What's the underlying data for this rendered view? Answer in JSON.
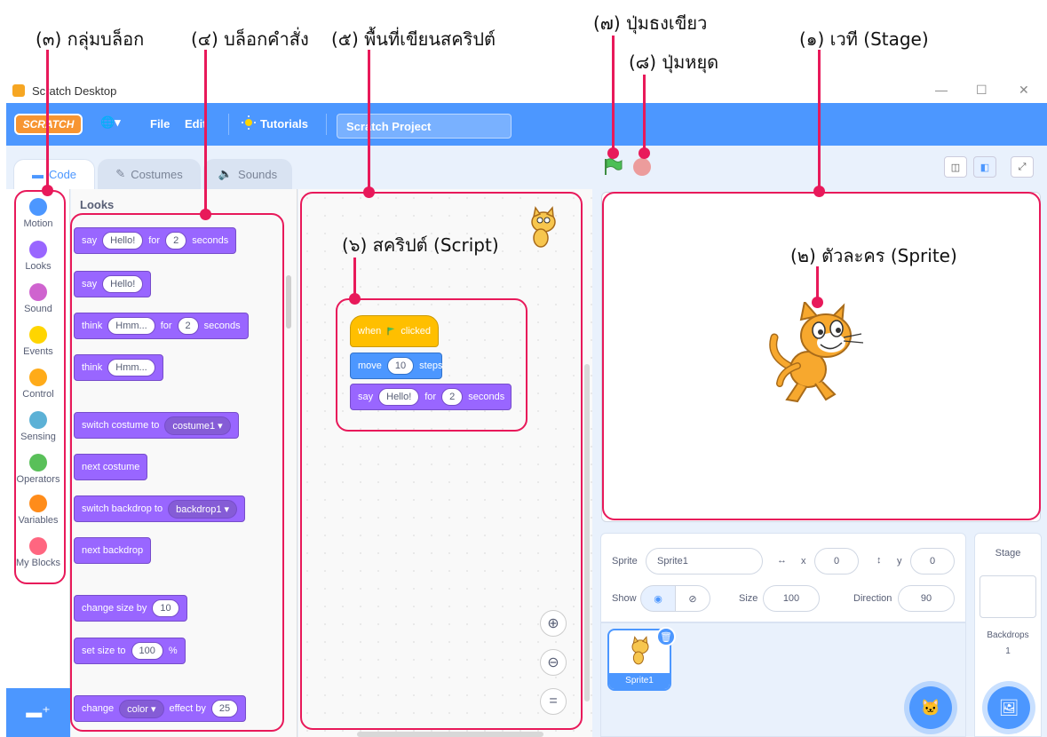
{
  "annotations": {
    "blocks_group": "(๓) กลุ่มบล็อก",
    "command_blocks": "(๔) บล็อกคำสั่ง",
    "script_area": "(๕) พื้นที่เขียนสคริปต์",
    "green_flag": "(๗) ปุ่มธงเขียว",
    "stop_button": "(๘) ปุ่มหยุด",
    "stage": "(๑) เวที (Stage)",
    "script": "(๖) สคริปต์ (Script)",
    "sprite": "(๒) ตัวละคร (Sprite)"
  },
  "window": {
    "title": "Scratch Desktop",
    "minimize": "—",
    "maximize": "☐",
    "close": "✕"
  },
  "menubar": {
    "logo": "SCRATCH",
    "globe": "🌐▾",
    "file": "File",
    "edit": "Edit",
    "tutorials": "Tutorials",
    "project_title": "Scratch Project"
  },
  "tabs": {
    "code": "Code",
    "costumes": "Costumes",
    "sounds": "Sounds"
  },
  "categories": [
    {
      "label": "Motion",
      "color": "#4c97ff"
    },
    {
      "label": "Looks",
      "color": "#9966ff"
    },
    {
      "label": "Sound",
      "color": "#cf63cf"
    },
    {
      "label": "Events",
      "color": "#ffd500"
    },
    {
      "label": "Control",
      "color": "#ffab19"
    },
    {
      "label": "Sensing",
      "color": "#5cb1d6"
    },
    {
      "label": "Operators",
      "color": "#59c059"
    },
    {
      "label": "Variables",
      "color": "#ff8c1a"
    },
    {
      "label": "My Blocks",
      "color": "#ff6680"
    }
  ],
  "palette": {
    "heading": "Looks",
    "say_for": {
      "word1": "say",
      "text": "Hello!",
      "word2": "for",
      "num": "2",
      "word3": "seconds"
    },
    "say": {
      "word1": "say",
      "text": "Hello!"
    },
    "think_for": {
      "word1": "think",
      "text": "Hmm...",
      "word2": "for",
      "num": "2",
      "word3": "seconds"
    },
    "think": {
      "word1": "think",
      "text": "Hmm..."
    },
    "switch_costume": {
      "label": "switch costume to",
      "value": "costume1 ▾"
    },
    "next_costume": "next costume",
    "switch_backdrop": {
      "label": "switch backdrop to",
      "value": "backdrop1 ▾"
    },
    "next_backdrop": "next backdrop",
    "change_size": {
      "label": "change size by",
      "num": "10"
    },
    "set_size": {
      "label": "set size to",
      "num": "100",
      "suffix": "%"
    },
    "change_effect": {
      "word1": "change",
      "value": "color ▾",
      "word2": "effect by",
      "num": "25"
    }
  },
  "script": {
    "when": "when",
    "clicked": "clicked",
    "move": "move",
    "move_num": "10",
    "steps": "steps",
    "say": "say",
    "say_text": "Hello!",
    "for": "for",
    "say_num": "2",
    "seconds": "seconds"
  },
  "zoom": {
    "in": "⊕",
    "out": "⊖",
    "reset": "="
  },
  "sprite_info": {
    "sprite_label": "Sprite",
    "sprite_name": "Sprite1",
    "x_label": "x",
    "x_value": "0",
    "y_label": "y",
    "y_value": "0",
    "show_label": "Show",
    "size_label": "Size",
    "size_value": "100",
    "direction_label": "Direction",
    "direction_value": "90"
  },
  "sprite_list": {
    "card_name": "Sprite1"
  },
  "stage_pane": {
    "title": "Stage",
    "backdrops_label": "Backdrops",
    "backdrops_count": "1"
  }
}
